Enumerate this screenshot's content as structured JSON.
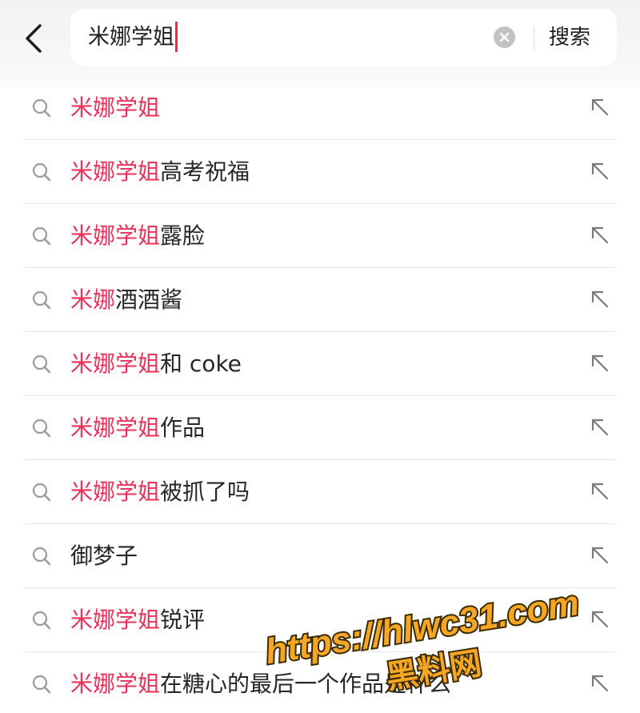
{
  "search": {
    "query": "米娜学姐",
    "button_label": "搜索"
  },
  "icons": {
    "back": "chevron-left-icon",
    "clear": "clear-x-circle-icon",
    "suggestion": "magnifier-icon",
    "fill": "arrow-up-left-icon"
  },
  "colors": {
    "highlight": "#e8325a",
    "caret": "#f0294f",
    "watermark_fill": "#f5a623"
  },
  "suggestions": [
    {
      "highlight": "米娜学姐",
      "rest": ""
    },
    {
      "highlight": "米娜学姐",
      "rest": "高考祝福"
    },
    {
      "highlight": "米娜学姐",
      "rest": "露脸"
    },
    {
      "highlight": "米娜",
      "rest": "酒酒酱"
    },
    {
      "highlight": "米娜学姐",
      "rest": "和 coke"
    },
    {
      "highlight": "米娜学姐",
      "rest": "作品"
    },
    {
      "highlight": "米娜学姐",
      "rest": "被抓了吗"
    },
    {
      "highlight": "",
      "rest": "御梦子"
    },
    {
      "highlight": "米娜学姐",
      "rest": "锐评"
    },
    {
      "highlight": "米娜学姐",
      "rest": "在糖心的最后一个作品是什么"
    }
  ],
  "watermark": {
    "line1": "https://hlwc31.com",
    "line2": "黑料网"
  }
}
